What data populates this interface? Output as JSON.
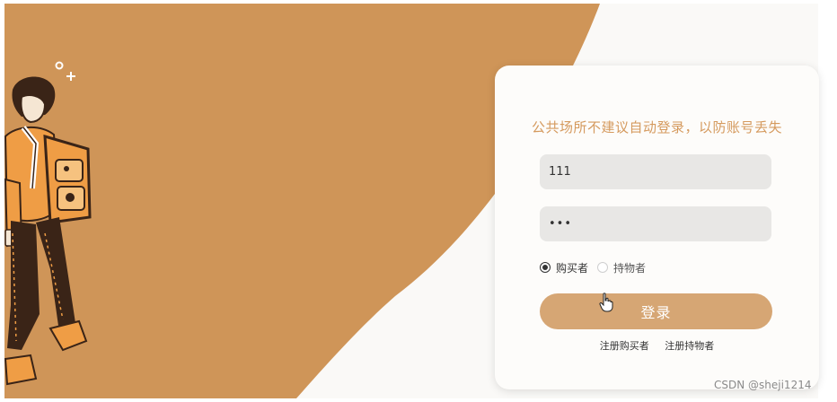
{
  "colors": {
    "background_brown": "#cf9558",
    "accent_text": "#d59a5e",
    "button_bg": "#d6a674",
    "field_bg": "#e8e7e5"
  },
  "login": {
    "notice": "公共场所不建议自动登录，以防账号丢失",
    "username_value": "111",
    "password_value": "111",
    "roles": [
      {
        "label": "购买者",
        "selected": true
      },
      {
        "label": "持物者",
        "selected": false
      }
    ],
    "submit_label": "登录",
    "register_links": [
      "注册购买者",
      "注册持物者"
    ]
  },
  "watermark": "CSDN @sheji1214",
  "icons": {
    "illustration": "backpacker-illustration",
    "cursor": "hand-pointer-icon",
    "sparkle": "sparkle-icon"
  }
}
